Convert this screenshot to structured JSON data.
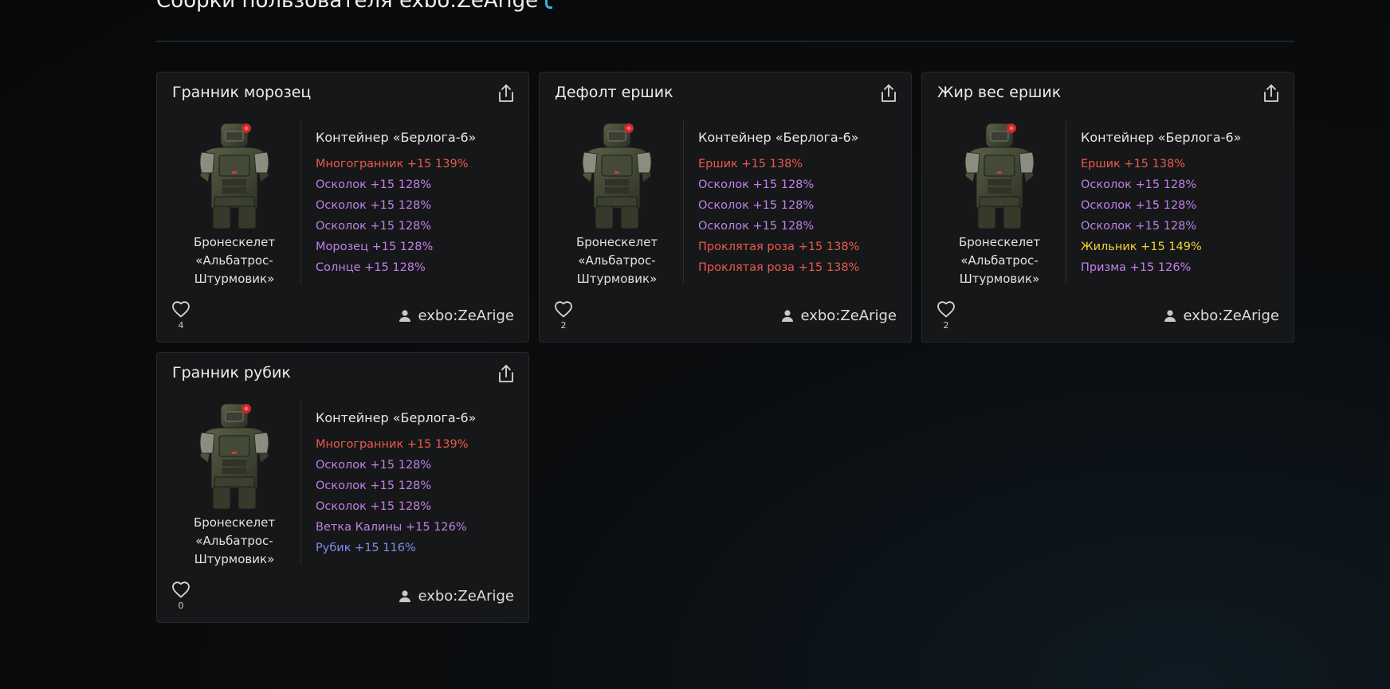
{
  "page": {
    "title": "Сборки пользователя exbo:ZeArige"
  },
  "colors": {
    "red": "#ea5a4e",
    "purple": "#c081e8",
    "yellow": "#f2d23c",
    "blue": "#7f8cf0"
  },
  "builds": [
    {
      "title": "Гранник морозец",
      "item_name": "Бронескелет «Альбатрос-Штурмовик»",
      "container": "Контейнер «Берлога-6»",
      "mods": [
        {
          "text": "Многогранник +15 139%",
          "color": "#ea5a4e"
        },
        {
          "text": "Осколок +15 128%",
          "color": "#c081e8"
        },
        {
          "text": "Осколок +15 128%",
          "color": "#c081e8"
        },
        {
          "text": "Осколок +15 128%",
          "color": "#c081e8"
        },
        {
          "text": "Морозец +15 128%",
          "color": "#c081e8"
        },
        {
          "text": "Солнце +15 128%",
          "color": "#c081e8"
        }
      ],
      "likes": "4",
      "author": "exbo:ZeArige"
    },
    {
      "title": "Дефолт ершик",
      "item_name": "Бронескелет «Альбатрос-Штурмовик»",
      "container": "Контейнер «Берлога-6»",
      "mods": [
        {
          "text": "Ершик +15 138%",
          "color": "#ea5a4e"
        },
        {
          "text": "Осколок +15 128%",
          "color": "#c081e8"
        },
        {
          "text": "Осколок +15 128%",
          "color": "#c081e8"
        },
        {
          "text": "Осколок +15 128%",
          "color": "#c081e8"
        },
        {
          "text": "Проклятая роза +15 138%",
          "color": "#ea5a4e"
        },
        {
          "text": "Проклятая роза +15 138%",
          "color": "#ea5a4e"
        }
      ],
      "likes": "2",
      "author": "exbo:ZeArige"
    },
    {
      "title": "Жир вес ершик",
      "item_name": "Бронескелет «Альбатрос-Штурмовик»",
      "container": "Контейнер «Берлога-6»",
      "mods": [
        {
          "text": "Ершик +15 138%",
          "color": "#ea5a4e"
        },
        {
          "text": "Осколок +15 128%",
          "color": "#c081e8"
        },
        {
          "text": "Осколок +15 128%",
          "color": "#c081e8"
        },
        {
          "text": "Осколок +15 128%",
          "color": "#c081e8"
        },
        {
          "text": "Жильник +15 149%",
          "color": "#f2d23c"
        },
        {
          "text": "Призма +15 126%",
          "color": "#c081e8"
        }
      ],
      "likes": "2",
      "author": "exbo:ZeArige"
    },
    {
      "title": "Гранник рубик",
      "item_name": "Бронескелет «Альбатрос-Штурмовик»",
      "container": "Контейнер «Берлога-6»",
      "mods": [
        {
          "text": "Многогранник +15 139%",
          "color": "#ea5a4e"
        },
        {
          "text": "Осколок +15 128%",
          "color": "#c081e8"
        },
        {
          "text": "Осколок +15 128%",
          "color": "#c081e8"
        },
        {
          "text": "Осколок +15 128%",
          "color": "#c081e8"
        },
        {
          "text": "Ветка Калины +15 126%",
          "color": "#c081e8"
        },
        {
          "text": "Рубик +15 116%",
          "color": "#7f8cf0"
        }
      ],
      "likes": "0",
      "author": "exbo:ZeArige"
    }
  ]
}
